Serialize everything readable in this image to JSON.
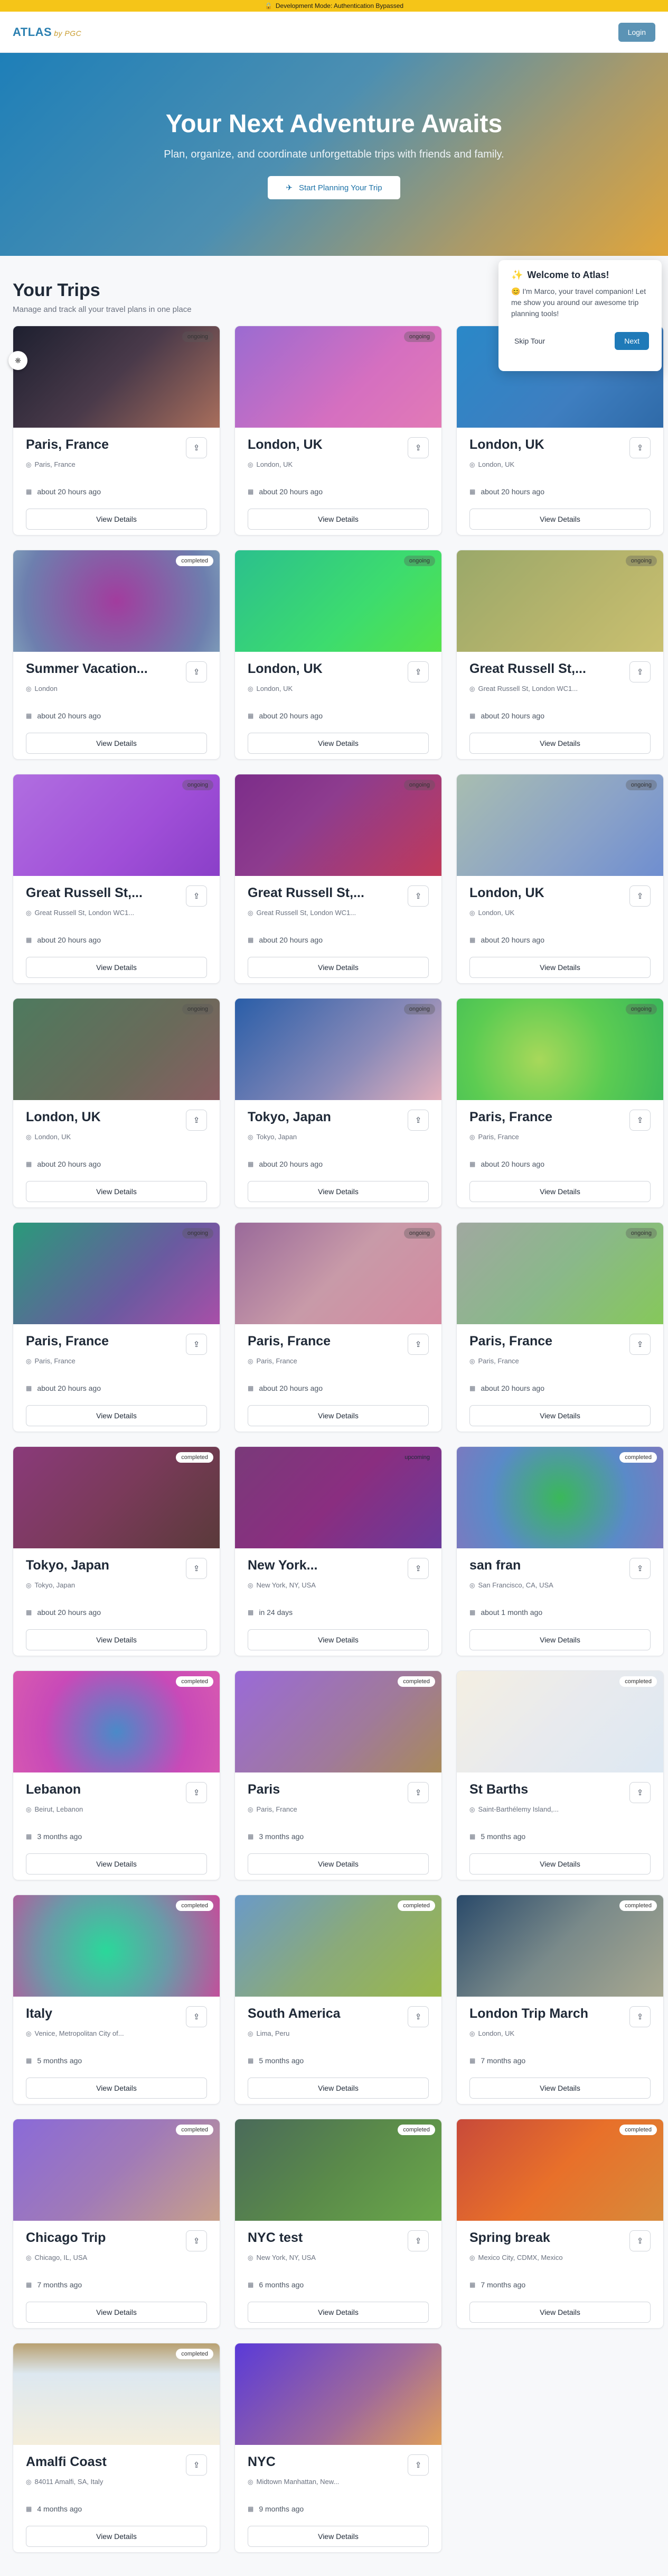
{
  "devbar": {
    "text": "Development Mode: Authentication Bypassed",
    "icon": "lock-icon"
  },
  "nav": {
    "logo": "ATLAS",
    "logo_sub": "by PGC",
    "login_label": "Login"
  },
  "hero": {
    "title": "Your Next Adventure Awaits",
    "subtitle": "Plan, organize, and coordinate unforgettable trips with friends and family.",
    "cta": "Start Planning Your Trip"
  },
  "trips_section": {
    "title": "Your Trips",
    "subtitle": "Manage and track all your travel plans in one place"
  },
  "welcome": {
    "title": "Welcome to Atlas!",
    "body": "I'm Marco, your travel companion! Let me show you around our awesome trip planning tools!",
    "skip_label": "Skip Tour",
    "next_label": "Next"
  },
  "view_details_label": "View Details",
  "trips": [
    {
      "title": "Paris, France",
      "location": "Paris, France",
      "time": "about 20 hours ago",
      "status": "ongoing",
      "gradient": "linear-gradient(135deg,#1e2030 0%,#4a3a4a 50%,#a86e5c 100%)"
    },
    {
      "title": "London, UK",
      "location": "London, UK",
      "time": "about 20 hours ago",
      "status": "ongoing",
      "gradient": "linear-gradient(135deg,#9b6bd1 0%,#d56fc0 60%,#e27ab6 100%)"
    },
    {
      "title": "London, UK",
      "location": "London, UK",
      "time": "about 20 hours ago",
      "status": "ongoing",
      "gradient": "linear-gradient(135deg,#2a88c8 0%,#3e7ec0 60%,#2f6aa8 100%)"
    },
    {
      "title": "Summer Vacation...",
      "location": "London",
      "time": "about 20 hours ago",
      "status": "completed",
      "gradient": "radial-gradient(circle at 50% 50%,#a23c9e 0%,#6d7fae 80%,#7d9ab8 100%)"
    },
    {
      "title": "London, UK",
      "location": "London, UK",
      "time": "about 20 hours ago",
      "status": "ongoing",
      "gradient": "linear-gradient(135deg,#2bc08d 0%,#3ddc6e 60%,#55e34a 100%)"
    },
    {
      "title": "Great Russell St,...",
      "location": "Great Russell St, London WC1...",
      "time": "about 20 hours ago",
      "status": "ongoing",
      "gradient": "linear-gradient(135deg,#9aa86a 0%,#b8b56c 60%,#c9c070 100%)"
    },
    {
      "title": "Great Russell St,...",
      "location": "Great Russell St, London WC1...",
      "time": "about 20 hours ago",
      "status": "ongoing",
      "gradient": "linear-gradient(135deg,#b06ee0 0%,#a04fd8 60%,#8a3fc8 100%)"
    },
    {
      "title": "Great Russell St,...",
      "location": "Great Russell St, London WC1...",
      "time": "about 20 hours ago",
      "status": "ongoing",
      "gradient": "linear-gradient(135deg,#7c2d8a 0%,#8e3c8e 40%,#c03a5a 100%)"
    },
    {
      "title": "London, UK",
      "location": "London, UK",
      "time": "about 20 hours ago",
      "status": "ongoing",
      "gradient": "linear-gradient(135deg,#a8bdb0 0%,#8aa2c8 60%,#6f8ed0 100%)"
    },
    {
      "title": "London, UK",
      "location": "London, UK",
      "time": "about 20 hours ago",
      "status": "ongoing",
      "gradient": "linear-gradient(135deg,#4e7a5e 0%,#6a6a5a 60%,#8a5e62 100%)"
    },
    {
      "title": "Tokyo, Japan",
      "location": "Tokyo, Japan",
      "time": "about 20 hours ago",
      "status": "ongoing",
      "gradient": "linear-gradient(135deg,#2a5ea8 0%,#8a8ab8 60%,#e2b0bc 100%)"
    },
    {
      "title": "Paris, France",
      "location": "Paris, France",
      "time": "about 20 hours ago",
      "status": "ongoing",
      "gradient": "radial-gradient(circle at 40% 60%,#a8d85a 0%,#5ccc52 50%,#3ab85a 100%)"
    },
    {
      "title": "Paris, France",
      "location": "Paris, France",
      "time": "about 20 hours ago",
      "status": "ongoing",
      "gradient": "linear-gradient(135deg,#2a9a7a 0%,#6a5aa0 60%,#a84fa8 100%)"
    },
    {
      "title": "Paris, France",
      "location": "Paris, France",
      "time": "about 20 hours ago",
      "status": "ongoing",
      "gradient": "linear-gradient(135deg,#9a6a9a 0%,#c89aa8 50%,#d48aa0 100%)"
    },
    {
      "title": "Paris, France",
      "location": "Paris, France",
      "time": "about 20 hours ago",
      "status": "ongoing",
      "gradient": "linear-gradient(135deg,#a0a8a0 0%,#8ab88a 50%,#86c85a 100%)"
    },
    {
      "title": "Tokyo, Japan",
      "location": "Tokyo, Japan",
      "time": "about 20 hours ago",
      "status": "completed",
      "gradient": "linear-gradient(135deg,#8a3a7a 0%,#7a3a5a 50%,#5a3a3a 100%)"
    },
    {
      "title": "New York...",
      "location": "New York, NY, USA",
      "time": "in 24 days",
      "status": "upcoming",
      "gradient": "linear-gradient(135deg,#7a3a7a 0%,#8a2e80 50%,#6a3a9a 100%)"
    },
    {
      "title": "san fran",
      "location": "San Francisco, CA, USA",
      "time": "about 1 month ago",
      "status": "completed",
      "gradient": "radial-gradient(circle at 50% 50%,#3ab85a 0%,#5a8ac8 60%,#7a7ac0 100%)"
    },
    {
      "title": "Lebanon",
      "location": "Beirut, Lebanon",
      "time": "3 months ago",
      "status": "completed",
      "gradient": "radial-gradient(circle at 50% 60%,#4a8ac8 0%,#c84ab8 60%,#d85ab0 100%)"
    },
    {
      "title": "Paris",
      "location": "Paris, France",
      "time": "3 months ago",
      "status": "completed",
      "gradient": "linear-gradient(135deg,#9a6ad8 0%,#a07a9a 60%,#a88a5a 100%)"
    },
    {
      "title": "St Barths",
      "location": "Saint-Barthélemy Island,...",
      "time": "5 months ago",
      "status": "completed",
      "gradient": "linear-gradient(135deg,#f4efe2 0%,#e8eaee 50%,#dde8f2 100%)"
    },
    {
      "title": "Italy",
      "location": "Venice, Metropolitan City of...",
      "time": "5 months ago",
      "status": "completed",
      "gradient": "radial-gradient(circle at 45% 55%,#2ad89a 0%,#6a9aa8 50%,#c84a9a 100%)"
    },
    {
      "title": "South America",
      "location": "Lima, Peru",
      "time": "5 months ago",
      "status": "completed",
      "gradient": "linear-gradient(135deg,#6a9ac8 0%,#8aaa7a 50%,#9ab84a 100%)"
    },
    {
      "title": "London Trip March",
      "location": "London, UK",
      "time": "7 months ago",
      "status": "completed",
      "gradient": "linear-gradient(135deg,#2a4a6a 0%,#7a8a8a 50%,#a8a890 100%)"
    },
    {
      "title": "Chicago Trip",
      "location": "Chicago, IL, USA",
      "time": "7 months ago",
      "status": "completed",
      "gradient": "linear-gradient(135deg,#8a6ad8 0%,#a07ab8 50%,#c8a08a 100%)"
    },
    {
      "title": "NYC test",
      "location": "New York, NY, USA",
      "time": "6 months ago",
      "status": "completed",
      "gradient": "linear-gradient(135deg,#4a6a5a 0%,#5a8a4a 50%,#6aa84a 100%)"
    },
    {
      "title": "Spring break",
      "location": "Mexico City, CDMX, Mexico",
      "time": "7 months ago",
      "status": "completed",
      "gradient": "linear-gradient(135deg,#c84a3a 0%,#e8702a 50%,#d88a3a 100%)"
    },
    {
      "title": "Amalfi Coast",
      "location": "84011 Amalfi, SA, Italy",
      "time": "4 months ago",
      "status": "completed",
      "gradient": "linear-gradient(180deg,#b8a070 0%,#dde8f0 30%,#f4eedc 100%)"
    },
    {
      "title": "NYC",
      "location": "Midtown Manhattan, New...",
      "time": "9 months ago",
      "status": "",
      "gradient": "linear-gradient(135deg,#5a3ad8 0%,#a06a9a 60%,#e0a05a 100%)"
    }
  ]
}
